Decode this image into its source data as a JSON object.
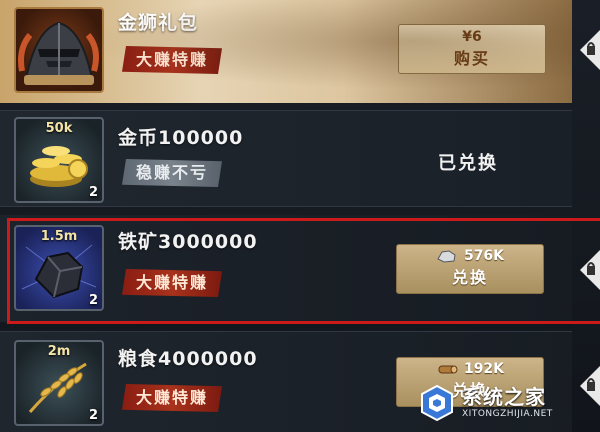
{
  "items": [
    {
      "title": "金狮礼包",
      "tag": "大赚特赚",
      "tag_style": "red",
      "price": "¥6",
      "action": "购买",
      "icon": "helmet-icon"
    },
    {
      "title": "金币100000",
      "tag": "稳赚不亏",
      "tag_style": "grey",
      "amount": "50k",
      "count": "2",
      "status": "已兑换",
      "icon": "gold-coins-icon"
    },
    {
      "title": "铁矿3000000",
      "tag": "大赚特赚",
      "tag_style": "red",
      "amount": "1.5m",
      "count": "2",
      "cost": "576K",
      "cost_icon": "iron-ore-icon",
      "action": "兑换",
      "icon": "iron-ore-icon",
      "highlighted": true
    },
    {
      "title": "粮食4000000",
      "tag": "大赚特赚",
      "tag_style": "red",
      "amount": "2m",
      "count": "2",
      "cost": "192K",
      "cost_icon": "wood-log-icon",
      "action": "兑换",
      "icon": "wheat-icon"
    }
  ],
  "watermark": {
    "name": "系统之家",
    "url": "XITONGZHIJIA.NET"
  },
  "colors": {
    "highlight": "#cc1a1a",
    "tag_red": "#a8321c",
    "tag_grey": "#7a838c",
    "button_gold": "#d9c296"
  }
}
